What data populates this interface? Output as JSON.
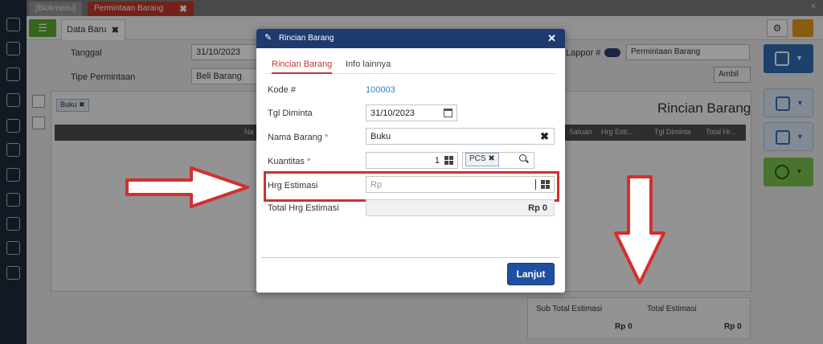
{
  "tabs": [
    {
      "label": "[Blokmenu]"
    },
    {
      "label": "Permintaan Barang"
    }
  ],
  "subtab": {
    "label": "Data Baru"
  },
  "background_form": {
    "tanggal_label": "Tanggal",
    "tanggal_value": "31/10/2023",
    "tipe_label": "Tipe Permintaan",
    "tipe_value": "Beli Barang",
    "laporan_label": "Lappor #",
    "laporan_select": "Permintaan Barang",
    "ambil_button": "Ambil",
    "filter_chip": "Buku",
    "section_title": "Rincian Barang",
    "grid_columns": [
      "Na",
      "Satuan",
      "Hrg Esti...",
      "Tgl Diminta",
      "Total Hr..."
    ],
    "summary": {
      "sub_total_label": "Sub Total Estimasi",
      "sub_total_value": "Rp 0",
      "total_label": "Total Estimasi",
      "total_value": "Rp 0"
    }
  },
  "modal": {
    "title": "Rincian Barang",
    "tabs": [
      {
        "label": "Rincian Barang",
        "active": true
      },
      {
        "label": "Info lainnya",
        "active": false
      }
    ],
    "fields": {
      "kode_label": "Kode #",
      "kode_value": "100003",
      "tgl_label": "Tgl Diminta",
      "tgl_value": "31/10/2023",
      "nama_label": "Nama Barang",
      "nama_value": "Buku",
      "kuantitas_label": "Kuantitas",
      "kuantitas_value": "1",
      "unit_value": "PCS",
      "hrg_label": "Hrg Estimasi",
      "hrg_prefix": "Rp",
      "hrg_value": "",
      "total_label": "Total Hrg Estimasi",
      "total_value": "Rp 0"
    },
    "required_mark": "*",
    "submit_button": "Lanjut"
  },
  "colors": {
    "modal_header": "#1f3a6e",
    "accent_red": "#c0392b",
    "highlight_red": "#d32f2f",
    "primary_button": "#1f4fa0",
    "link_blue": "#2a86c8"
  }
}
